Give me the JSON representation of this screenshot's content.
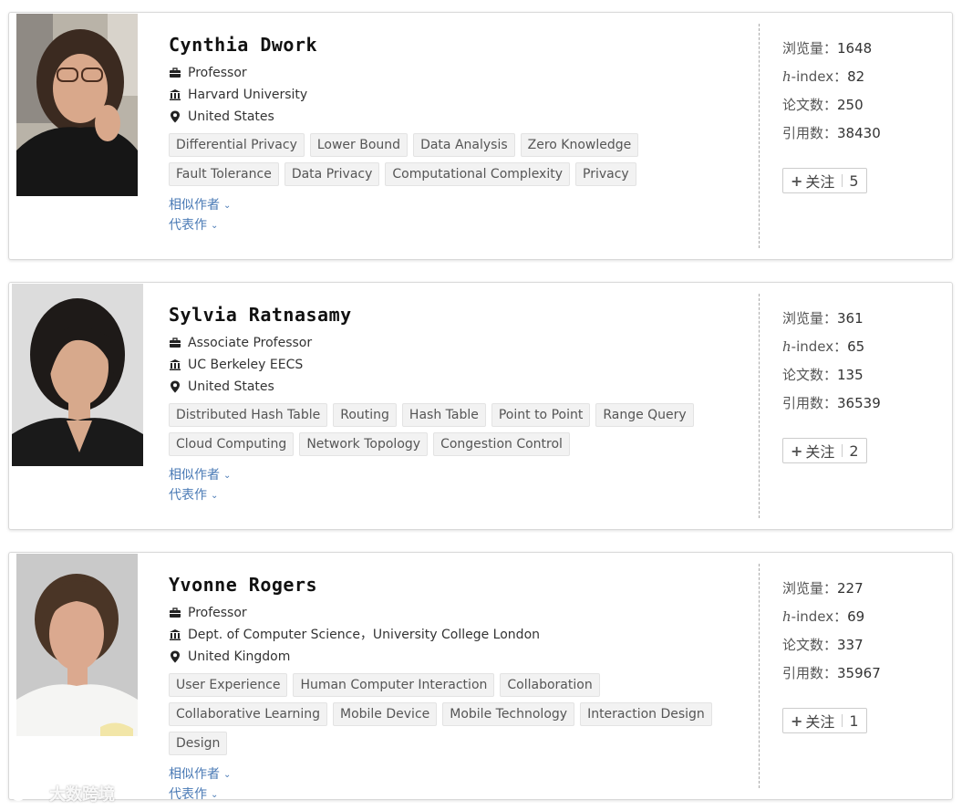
{
  "labels": {
    "views": "浏览量：",
    "hindex_prefix": "h",
    "hindex_suffix": "-index：",
    "papers": "论文数：",
    "citations": "引用数：",
    "similar_authors": "相似作者",
    "representative_works": "代表作",
    "follow": "关注"
  },
  "scholars": [
    {
      "name": "Cynthia Dwork",
      "position": "Professor",
      "affiliation": "Harvard University",
      "country": "United States",
      "tags": [
        "Differential Privacy",
        "Lower Bound",
        "Data Analysis",
        "Zero Knowledge",
        "Fault Tolerance",
        "Data Privacy",
        "Computational Complexity",
        "Privacy"
      ],
      "views": "1648",
      "hindex": "82",
      "papers": "250",
      "citations": "38430",
      "followers": "5"
    },
    {
      "name": "Sylvia Ratnasamy",
      "position": "Associate Professor",
      "affiliation": "UC Berkeley EECS",
      "country": "United States",
      "tags": [
        "Distributed Hash Table",
        "Routing",
        "Hash Table",
        "Point to Point",
        "Range Query",
        "Cloud Computing",
        "Network Topology",
        "Congestion Control"
      ],
      "views": "361",
      "hindex": "65",
      "papers": "135",
      "citations": "36539",
      "followers": "2"
    },
    {
      "name": "Yvonne Rogers",
      "position": "Professor",
      "affiliation": "Dept. of Computer Science，University College London",
      "country": "United Kingdom",
      "tags": [
        "User Experience",
        "Human Computer Interaction",
        "Collaboration",
        "Collaborative Learning",
        "Mobile Device",
        "Mobile Technology",
        "Interaction Design",
        "Design"
      ],
      "views": "227",
      "hindex": "69",
      "papers": "337",
      "citations": "35967",
      "followers": "1"
    }
  ],
  "watermark": "大数跨境",
  "colors": {
    "link": "#4a7ab5",
    "tag_bg": "#f2f2f2",
    "divider": "#aaaaaa"
  },
  "icons": {
    "position": "briefcase-icon",
    "affiliation": "institution-icon",
    "country": "location-pin-icon",
    "follow": "plus-icon"
  }
}
